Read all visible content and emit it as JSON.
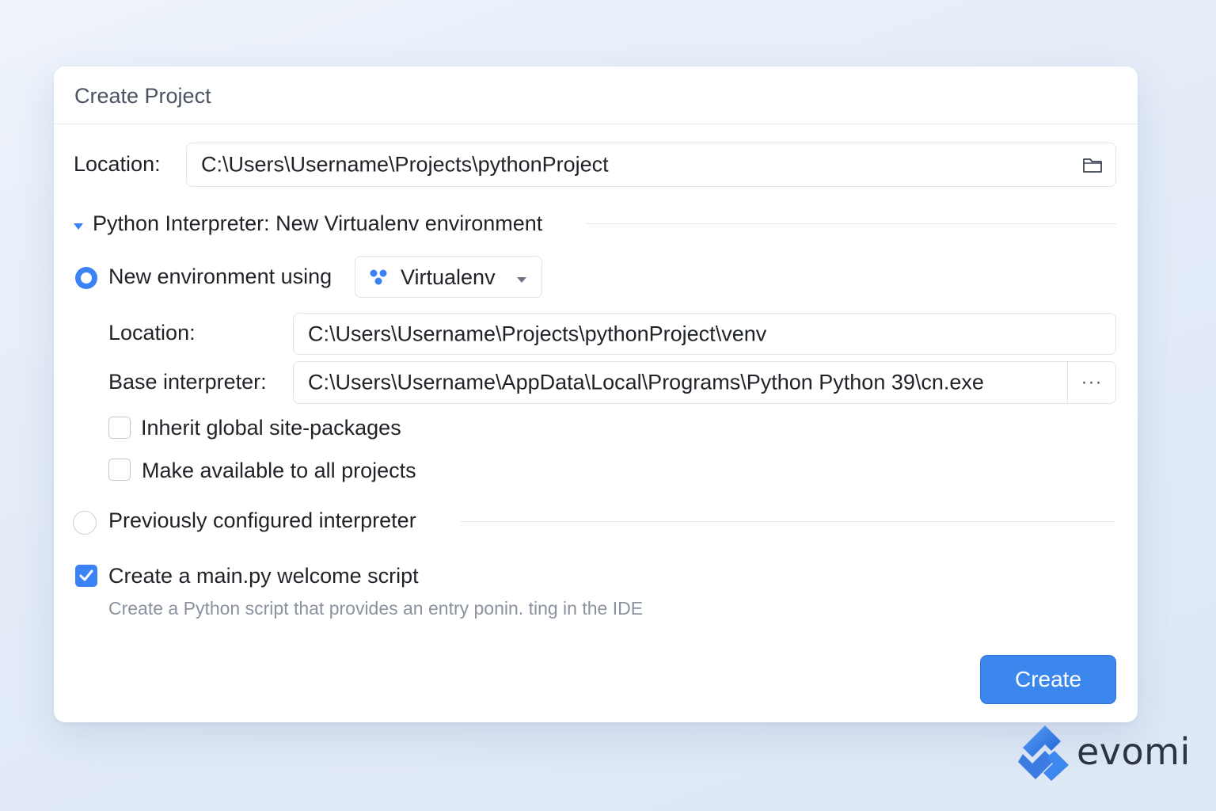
{
  "dialog": {
    "title": "Create Project",
    "location_label": "Location:",
    "location_value": "C:\\Users\\Username\\Projects\\pythonProject",
    "folder_icon": "folder-icon",
    "interpreter_section": "Python Interpreter: New Virtualenv environment",
    "new_env": {
      "label": "New environment using",
      "selected": true,
      "tool": "Virtualenv",
      "location_label": "Location:",
      "location_value": "C:\\Users\\Username\\Projects\\pythonProject\\venv",
      "base_label": "Base interpreter:",
      "base_value": "C:\\Users\\Username\\AppData\\Local\\Programs\\Python Python 39\\cn.exe",
      "browse_label": "···",
      "inherit_label": "Inherit global site-packages",
      "inherit_checked": false,
      "available_label": "Make available to all projects",
      "available_checked": false
    },
    "prev_interpreter": {
      "label": "Previously configured interpreter",
      "selected": false
    },
    "welcome": {
      "label": "Create a main.py welcome script",
      "checked": true,
      "hint": "Create a Python script that provides an entry ponin. ting in the IDE"
    },
    "create_button": "Create"
  },
  "branding": {
    "logo_text": "evomi"
  },
  "colors": {
    "accent": "#3b87ee",
    "background": "#e4ecf8"
  }
}
